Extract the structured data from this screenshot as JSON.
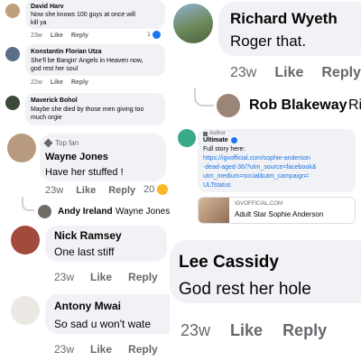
{
  "panel_top_left": {
    "comments": [
      {
        "name": "David Harv",
        "lines": [
          "Now she knows 100 guys at once will",
          "kill ya"
        ],
        "time": "23w",
        "like": "Like",
        "reply": "Reply",
        "reaction_count": "1"
      },
      {
        "name": "Konstantin Florian Utza",
        "lines": [
          "She'll be Bangin' Angels in Heaven now,",
          "god rest her soul"
        ],
        "time": "22w",
        "like": "Like",
        "reply": "Reply"
      },
      {
        "name": "Maverick Bohol",
        "lines": [
          "Maybe she died by those men giving too",
          "much orgie"
        ],
        "time": "",
        "like": "",
        "reply": ""
      }
    ]
  },
  "panel_top_right": {
    "comment": {
      "name": "Richard Wyeth",
      "text": "Roger that.",
      "time": "23w",
      "like": "Like",
      "reply": "Reply"
    },
    "reply_preview": {
      "name": "Rob Blakeway",
      "text": "Ri"
    }
  },
  "panel_middle_left": {
    "comment": {
      "badge": "Top fan",
      "name": "Wayne Jones",
      "text": "Have her stuffed !",
      "time": "23w",
      "like": "Like",
      "reply": "Reply",
      "reaction_count": "20"
    },
    "reply_preview": {
      "name": "Andy Ireland",
      "text": "Wayne Jones"
    }
  },
  "panel_middle_right": {
    "author_tag": "Author",
    "name": "Ultimate",
    "lines": [
      "Full story here:",
      "https://igvofficial.com/sophie-anderson",
      "-dead-aged-36/?utm_source=facebook&",
      "utm_medium=social&utm_campaign=",
      "ULTstatus"
    ],
    "preview": {
      "domain": "IGVOFFICIAL.COM",
      "title": "Adult Star Sophie Anderson"
    }
  },
  "panel_lower_left": {
    "comments": [
      {
        "name": "Nick Ramsey",
        "text": "One last stiff",
        "time": "23w",
        "like": "Like",
        "reply": "Reply"
      },
      {
        "name": "Antony Mwai",
        "text": "So sad u won't wate",
        "time": "23w",
        "like": "Like",
        "reply": "Reply"
      }
    ]
  },
  "panel_lower_right": {
    "comment": {
      "name": "Lee Cassidy",
      "text": "God rest her hole",
      "time": "23w",
      "like": "Like",
      "reply": "Reply"
    }
  },
  "colors": {
    "bubble": "#f0f2f5",
    "meta_text": "#65676b",
    "link": "#1b74e4",
    "verified": "#1877f2"
  },
  "icons": [
    "verified-badge-icon",
    "reaction-like-icon",
    "reaction-haha-icon",
    "top-fan-badge-icon"
  ]
}
